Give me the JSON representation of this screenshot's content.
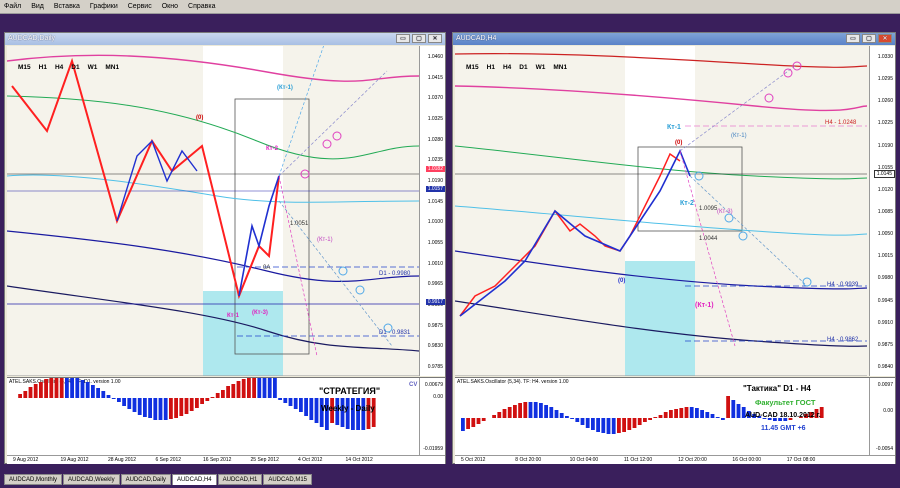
{
  "menu": [
    "Файл",
    "Вид",
    "Вставка",
    "Графики",
    "Сервис",
    "Окно",
    "Справка"
  ],
  "left": {
    "title": "AUDCAD,Daily",
    "timeframes": [
      "M15",
      "H1",
      "H4",
      "D1",
      "W1",
      "MN1"
    ],
    "prices": [
      "1.0460",
      "1.0415",
      "1.0370",
      "1.0325",
      "1.0280",
      "1.0235",
      "1.0190",
      "1.0145",
      "1.0100",
      "1.0055",
      "1.0010",
      "0.9965",
      "0.9920",
      "0.9875",
      "0.9830",
      "0.9785"
    ],
    "badge1": "1.0182",
    "badge2": "1.0157",
    "badge3": "0.9917",
    "labels": {
      "kt1_top": "(Кт-1)",
      "zero": "(0)",
      "kt2": "Кт-2",
      "kt3_small": "(Кт-3)",
      "kt1_small": "(Кт-1)",
      "kt1_low": "Кт-1",
      "kt3_low": "(Кт-3)",
      "v1": "1.0051",
      "d1": "D1 - 0.9980",
      "d1b": "D1 - 0.9831",
      "oa": "0A"
    },
    "osc_label": "ATEL.SAKS.Oscillator (5,34). TF: D1. version 1.00",
    "osc_axis": [
      "0.00679",
      "0.00",
      "-0.01959"
    ],
    "strategy_title": "\"СТРАТЕГИЯ\"",
    "strategy_sub": "Weekly - Daily",
    "cv": "CV",
    "dates": [
      "9 Aug 2012",
      "19 Aug 2012",
      "28 Aug 2012",
      "6 Sep 2012",
      "16 Sep 2012",
      "25 Sep 2012",
      "4 Oct 2012",
      "14 Oct 2012"
    ]
  },
  "right": {
    "title": "AUDCAD,H4",
    "timeframes": [
      "M15",
      "H1",
      "H4",
      "D1",
      "W1",
      "MN1"
    ],
    "prices": [
      "1.0330",
      "1.0295",
      "1.0260",
      "1.0225",
      "1.0190",
      "1.0155",
      "1.0120",
      "1.0085",
      "1.0050",
      "1.0015",
      "0.9980",
      "0.9945",
      "0.9910",
      "0.9875",
      "0.9840"
    ],
    "badge1": "1.0145",
    "labels": {
      "kt1": "Кт-1",
      "zero_top": "(0)",
      "kt2": "Кт-2",
      "kt1_paren": "(Кт-1)",
      "kt3": "(Кт-3)",
      "zero_low": "(0)",
      "kt1_low": "(Кт-1)",
      "h4a": "H4 - 1.0248",
      "h4b": "H4 - 0.9939",
      "h4c": "H4 - 0.9862",
      "v1": "1.0095",
      "v2": "1.0044"
    },
    "osc_label": "ATEL.SAKS.Oscillator (5,34). TF: H4. version 1.00",
    "osc_axis": [
      "0.0097",
      "0.00",
      "-0.0054"
    ],
    "tactic_title": "\"Тактика\"  D1 - H4",
    "faculty": "Факультет ГОСТ",
    "date_line": "AUD-CAD 18.10.2012  г.",
    "time_line": "11.45   GMT +6",
    "dates": [
      "5 Oct 2012",
      "8 Oct 20:00",
      "10 Oct 04:00",
      "11 Oct 12:00",
      "12 Oct 20:00",
      "16 Oct 00:00",
      "17 Oct 08:00"
    ]
  },
  "tabs": [
    "AUDCAD,Monthly",
    "AUDCAD,Weekly",
    "AUDCAD,Daily",
    "AUDCAD,H4",
    "AUDCAD,H1",
    "AUDCAD,M15"
  ],
  "active_tab": "AUDCAD,H4"
}
